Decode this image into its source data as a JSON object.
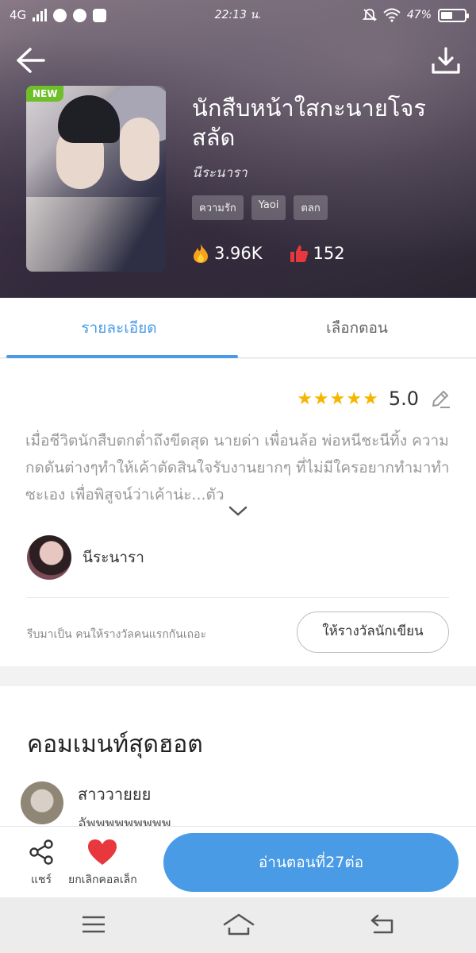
{
  "status_bar": {
    "network": "4G",
    "time": "22:13 น.",
    "battery": "47%",
    "icons": [
      "signal-icon",
      "line-icon",
      "chrome-icon",
      "youtube-icon",
      "mute-icon",
      "wifi-icon",
      "battery-icon"
    ]
  },
  "header": {
    "badge": "NEW",
    "title": "นักสืบหน้าใสกะนายโจรสลัด",
    "author": "นีระนารา",
    "tags": [
      "ความรัก",
      "Yaoi",
      "ตลก"
    ],
    "views": "3.96K",
    "likes": "152"
  },
  "tabs": [
    {
      "label": "รายละเอียด",
      "active": true
    },
    {
      "label": "เลือกตอน",
      "active": false
    }
  ],
  "detail": {
    "stars": "★★★★★",
    "rating": "5.0",
    "synopsis": "เมื่อชีวิตนักสืบตกต่ำถึงขีดสุด นายด่า เพื่อนล้อ พ่อหนีชะนีทิ้ง ความกดดันต่างๆทำให้เค้าตัดสินใจรับงานยากๆ ที่ไม่มีใครอยากทำมาทำซะเอง เพื่อพิสูจน์ว่าเค้าน่ะ...ตัว",
    "author_name": "นีระนารา",
    "reward_text": "รีบมาเป็น คนให้รางวัลคนแรกกันเถอะ",
    "reward_button": "ให้รางวัลนักเขียน"
  },
  "comments": {
    "title": "คอมเมนท์สุดฮอต",
    "items": [
      {
        "name": "สาววายยย",
        "text": "อัพพพพพพพพพ"
      }
    ]
  },
  "action_bar": {
    "share_label": "แชร์",
    "favorite_label": "ยกเลิกคอลเล็ก",
    "read_button": "อ่านตอนที่27ต่อ"
  },
  "colors": {
    "accent": "#4a9be6",
    "star": "#f7b500",
    "heart": "#e8383d",
    "new_badge": "#6fbf2b"
  }
}
